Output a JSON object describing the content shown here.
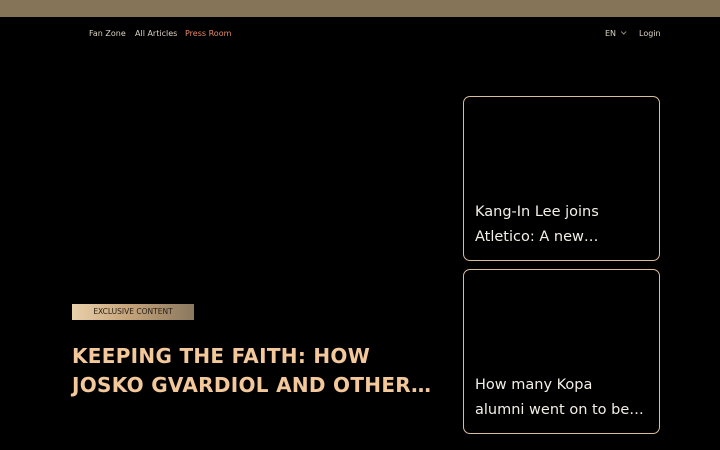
{
  "colors": {
    "top_bar": "#857457",
    "background": "#000000",
    "accent_gold": "#f3c89a",
    "active_link": "#e88a66",
    "card_border": "#d9bd99"
  },
  "nav": {
    "items": [
      {
        "label": "Fan Zone",
        "active": false
      },
      {
        "label": "All Articles",
        "active": false
      },
      {
        "label": "Press Room",
        "active": true
      }
    ],
    "language": "EN",
    "login": "Login"
  },
  "hero": {
    "badge": "EXCLUSIVE CONTENT",
    "title": "KEEPING THE FAITH: HOW JOSKO GVARDIOL AND OTHER…"
  },
  "cards": [
    {
      "title": "Kang-In Lee joins Atletico: A new…"
    },
    {
      "title": "How many Kopa alumni went on to be…"
    }
  ]
}
